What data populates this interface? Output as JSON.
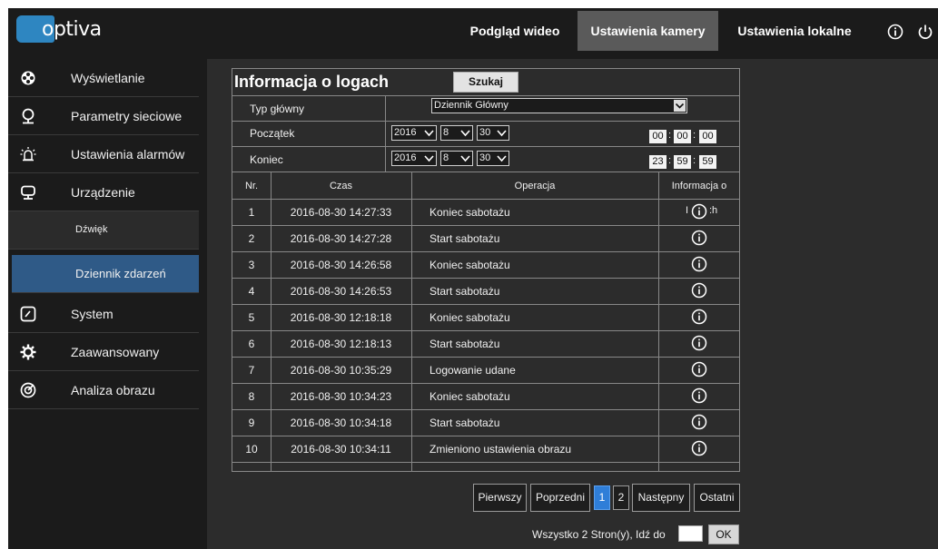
{
  "app": {
    "logo_text": "optiva"
  },
  "topnav": {
    "tabs": [
      {
        "label": "Podgląd wideo",
        "active": false
      },
      {
        "label": "Ustawienia kamery",
        "active": true
      },
      {
        "label": "Ustawienia lokalne",
        "active": false
      }
    ],
    "icons": [
      "info-icon",
      "power-icon"
    ]
  },
  "sidebar": {
    "items": [
      {
        "label": "Wyświetlanie",
        "icon": "display-icon"
      },
      {
        "label": "Parametry sieciowe",
        "icon": "network-icon"
      },
      {
        "label": "Ustawienia alarmów",
        "icon": "alarm-icon"
      },
      {
        "label": "Urządzenie",
        "icon": "device-icon"
      },
      {
        "label": "System",
        "icon": "system-icon"
      },
      {
        "label": "Zaawansowany",
        "icon": "advanced-icon"
      },
      {
        "label": "Analiza obrazu",
        "icon": "image-analysis-icon"
      }
    ],
    "subitems": [
      {
        "label": "Dźwięk",
        "active": false
      },
      {
        "label": "Dziennik zdarzeń",
        "active": true
      }
    ]
  },
  "panel": {
    "title": "Informacja o logach",
    "search_label": "Szukaj",
    "main_type_label": "Typ główny",
    "main_type_value": "Dziennik Główny",
    "start_label": "Początek",
    "end_label": "Koniec",
    "start": {
      "year": "2016",
      "month": "8",
      "day": "30",
      "hh": "00",
      "mm": "00",
      "ss": "00"
    },
    "end": {
      "year": "2016",
      "month": "8",
      "day": "30",
      "hh": "23",
      "mm": "59",
      "ss": "59"
    }
  },
  "table": {
    "headers": [
      "Nr.",
      "Czas",
      "Operacja",
      "Informacja o"
    ],
    "rows": [
      {
        "nr": "1",
        "time": "2016-08-30 14:27:33",
        "op": "Koniec sabotażu"
      },
      {
        "nr": "2",
        "time": "2016-08-30 14:27:28",
        "op": "Start sabotażu"
      },
      {
        "nr": "3",
        "time": "2016-08-30 14:26:58",
        "op": "Koniec sabotażu"
      },
      {
        "nr": "4",
        "time": "2016-08-30 14:26:53",
        "op": "Start sabotażu"
      },
      {
        "nr": "5",
        "time": "2016-08-30 12:18:18",
        "op": "Koniec sabotażu"
      },
      {
        "nr": "6",
        "time": "2016-08-30 12:18:13",
        "op": "Start sabotażu"
      },
      {
        "nr": "7",
        "time": "2016-08-30 10:35:29",
        "op": "Logowanie udane"
      },
      {
        "nr": "8",
        "time": "2016-08-30 10:34:23",
        "op": "Koniec sabotażu"
      },
      {
        "nr": "9",
        "time": "2016-08-30 10:34:18",
        "op": "Start sabotażu"
      },
      {
        "nr": "10",
        "time": "2016-08-30 10:34:11",
        "op": "Zmieniono ustawienia obrazu"
      }
    ],
    "tooltip_fragment_left": "I",
    "tooltip_fragment_right": ":h"
  },
  "pagination": {
    "first": "Pierwszy",
    "prev": "Poprzedni",
    "pages": [
      "1",
      "2"
    ],
    "current_page": "1",
    "next": "Następny",
    "last": "Ostatni",
    "goto_text": "Wszystko 2 Stron(y), Idź do",
    "ok": "OK"
  },
  "colors": {
    "background": "#1b1b1b",
    "panel": "#2c2c2c",
    "active_tab": "#5a5a5a",
    "active_sidebar": "#2f5a87",
    "active_page": "#2f7ed8"
  }
}
